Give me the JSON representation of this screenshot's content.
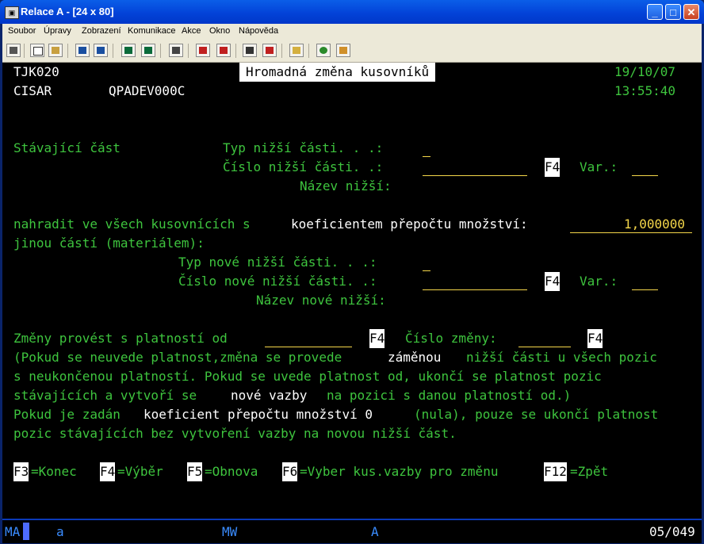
{
  "window": {
    "title": "Relace A - [24 x 80]",
    "icon": "terminal-icon",
    "min": "_",
    "max": "□",
    "close": "✕"
  },
  "menu": [
    "Soubor",
    "Úpravy",
    "Zobrazení",
    "Komunikace",
    "Akce",
    "Okno",
    "Nápověda"
  ],
  "toolbar": [
    "print-icon",
    "copy-icon",
    "paste-icon",
    "send-icon",
    "receive-icon",
    "display-icon",
    "keypad-icon",
    "chart-icon",
    "macro-record-icon",
    "macro-stop-icon",
    "macro-play-icon",
    "macro-edit-icon",
    "clipboard-icon",
    "globe-icon",
    "edit-icon"
  ],
  "screen": {
    "program": "TJK020",
    "date": "19/10/07",
    "user": "CISAR",
    "device": "QPADEV000C",
    "time": "13:55:40",
    "title": "Hromadná změna kusovníků",
    "stav": "Stávající část",
    "typ_nizsi": "Typ nižší části. . .:",
    "cislo_nizsi": "Číslo nižší části. .:",
    "f4": "F4",
    "var": "Var.:",
    "nazev_nizsi": "Název nižší:",
    "nahradit_a": "nahradit ve všech kusovnících s",
    "nahradit_b": "koeficientem přepočtu množství:",
    "koef_value": "1,000000",
    "jinou": "jinou částí (materiálem):",
    "typ_nove": "Typ nové nižší části. . .:",
    "cislo_nove": "Číslo nové nižší části. .:",
    "nazev_nove": "Název nové nižší:",
    "zmeny": "Změny provést s platností od",
    "cislo_zmeny": "Číslo změny:",
    "note1a": "(Pokud se neuvede platnost,změna se provede",
    "note1b": "záměnou",
    "note1c": "nižší části u všech pozic",
    "note2": "s neukončenou platností. Pokud se uvede platnost od, ukončí se platnost pozic",
    "note3a": "stávajících a vytvoří se",
    "note3b": "nové vazby",
    "note3c": "na pozici s danou platností od.)",
    "note4a": "Pokud je zadán",
    "note4b": "koeficient přepočtu množství 0",
    "note4c": "(nula), pouze se ukončí platnost",
    "note5": "pozic stávajících bez vytvoření vazby na novou nižší část.",
    "fkeys": [
      {
        "key": "F3",
        "label": "=Konec"
      },
      {
        "key": "F4",
        "label": "=Výběr"
      },
      {
        "key": "F5",
        "label": "=Obnova"
      },
      {
        "key": "F6",
        "label": "=Vyber kus.vazby pro změnu"
      },
      {
        "key": "F12",
        "label": "=Zpět"
      }
    ]
  },
  "status": {
    "mode": "MA",
    "input": "a",
    "mw": "MW",
    "session": "A",
    "pos": "05/049"
  }
}
